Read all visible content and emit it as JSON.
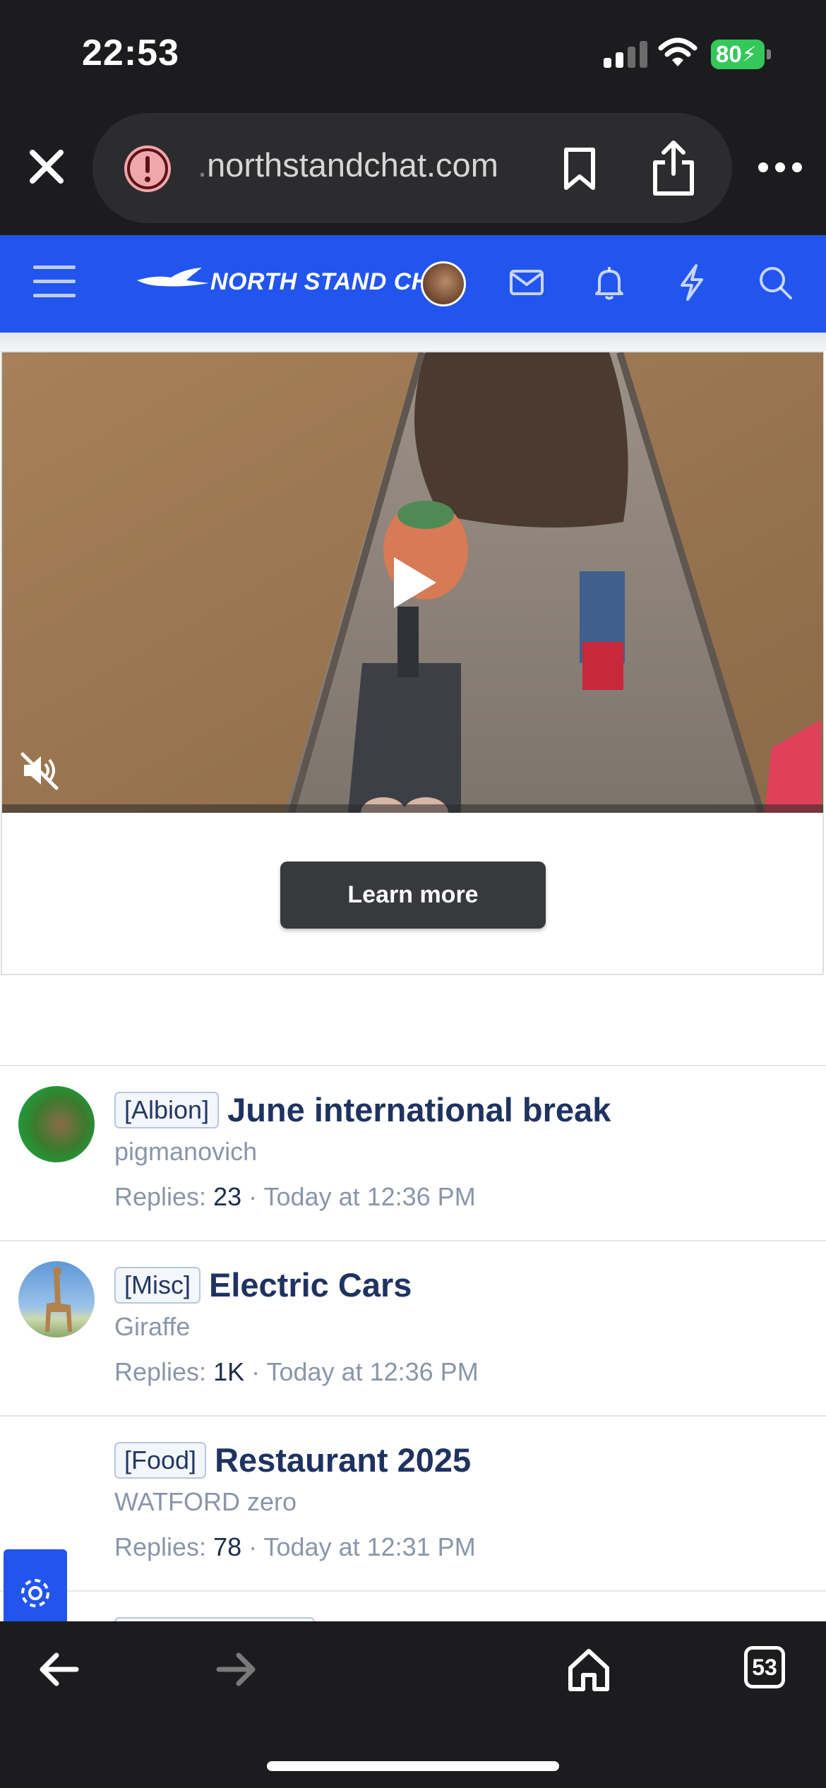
{
  "status_bar": {
    "time": "22:53",
    "battery": "80"
  },
  "browser": {
    "url_prefix": ".",
    "url_domain": "northstandchat.com",
    "tab_count": "53",
    "icons": [
      "close-icon",
      "warning-icon",
      "bookmark-icon",
      "share-icon",
      "more-icon",
      "back-icon",
      "forward-icon",
      "home-icon",
      "tabs-icon"
    ]
  },
  "site_header": {
    "logo_text": "NORTH STAND CHAT",
    "icons": [
      "menu-icon",
      "avatar",
      "mail-icon",
      "bell-icon",
      "lightning-icon",
      "search-icon"
    ],
    "accent_color": "#2255ee"
  },
  "ad": {
    "cta_label": "Learn more",
    "icons": [
      "play-icon",
      "muted-icon"
    ]
  },
  "threads": [
    {
      "prefix": "[Albion]",
      "title": "June international break",
      "author": "pigmanovich",
      "replies_label": "Replies:",
      "replies": "23",
      "separator": "·",
      "time": "Today at 12:36 PM"
    },
    {
      "prefix": "[Misc]",
      "title": "Electric Cars",
      "author": "Giraffe",
      "replies_label": "Replies:",
      "replies": "1K",
      "separator": "·",
      "time": "Today at 12:36 PM"
    },
    {
      "prefix": "[Food]",
      "title": "Restaurant 2025",
      "author": "WATFORD zero",
      "replies_label": "Replies:",
      "replies": "78",
      "separator": "·",
      "time": "Today at 12:31 PM"
    }
  ],
  "floating": {
    "settings_icon": "gear-icon"
  }
}
